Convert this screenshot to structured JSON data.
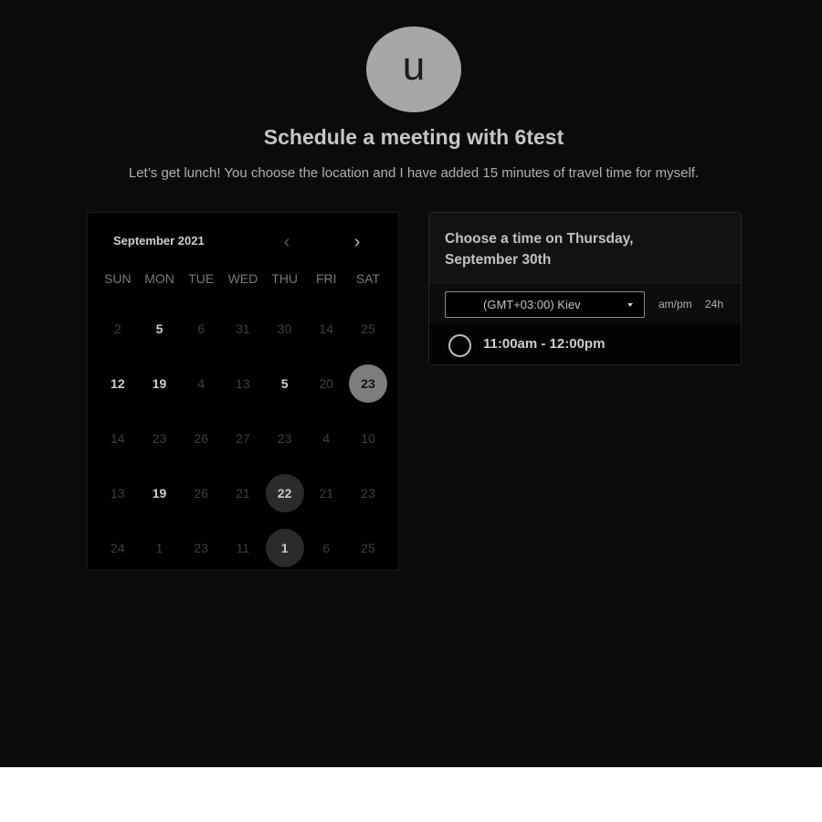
{
  "host": {
    "avatar_initial": "u",
    "title": "Schedule a meeting with 6test",
    "description": "Let’s get lunch! You choose the location and I have added 15 minutes of travel time for myself."
  },
  "calendar": {
    "month_label": "September 2021",
    "prev_icon": "chevron-left-icon",
    "next_icon": "chevron-right-icon",
    "prev_glyph": "‹",
    "next_glyph": "›",
    "weekdays": [
      "SUN",
      "MON",
      "TUE",
      "WED",
      "THU",
      "FRI",
      "SAT"
    ],
    "weeks": [
      [
        {
          "d": "2",
          "s": "muted"
        },
        {
          "d": "5",
          "s": "avail"
        },
        {
          "d": "6",
          "s": "muted"
        },
        {
          "d": "31",
          "s": "muted"
        },
        {
          "d": "30",
          "s": "muted"
        },
        {
          "d": "14",
          "s": "muted"
        },
        {
          "d": "25",
          "s": "muted"
        }
      ],
      [
        {
          "d": "12",
          "s": "avail"
        },
        {
          "d": "19",
          "s": "avail"
        },
        {
          "d": "4",
          "s": "muted"
        },
        {
          "d": "13",
          "s": "muted"
        },
        {
          "d": "5",
          "s": "avail"
        },
        {
          "d": "20",
          "s": "muted"
        },
        {
          "d": "23",
          "s": "selected"
        }
      ],
      [
        {
          "d": "14",
          "s": "muted"
        },
        {
          "d": "23",
          "s": "muted"
        },
        {
          "d": "26",
          "s": "muted"
        },
        {
          "d": "27",
          "s": "muted"
        },
        {
          "d": "23",
          "s": "muted"
        },
        {
          "d": "4",
          "s": "muted"
        },
        {
          "d": "10",
          "s": "muted"
        }
      ],
      [
        {
          "d": "13",
          "s": "muted"
        },
        {
          "d": "19",
          "s": "avail"
        },
        {
          "d": "26",
          "s": "muted"
        },
        {
          "d": "21",
          "s": "muted"
        },
        {
          "d": "22",
          "s": "circle"
        },
        {
          "d": "21",
          "s": "muted"
        },
        {
          "d": "23",
          "s": "muted"
        }
      ],
      [
        {
          "d": "24",
          "s": "muted"
        },
        {
          "d": "1",
          "s": "muted"
        },
        {
          "d": "23",
          "s": "muted"
        },
        {
          "d": "11",
          "s": "muted"
        },
        {
          "d": "1",
          "s": "circle"
        },
        {
          "d": "6",
          "s": "muted"
        },
        {
          "d": "25",
          "s": "muted"
        }
      ]
    ]
  },
  "time_panel": {
    "heading": "Choose a time on Thursday, September 30th",
    "timezone_value": "(GMT+03:00) Kiev",
    "format_ampm": "am/pm",
    "format_24h": "24h",
    "slots": [
      {
        "label": "11:00am - 12:00pm"
      }
    ]
  }
}
